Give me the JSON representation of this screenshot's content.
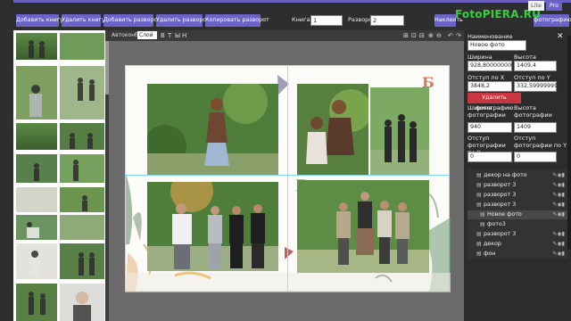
{
  "toolbar": {
    "add_book": "Добавить книгу",
    "delete_book": "Удалить книгу",
    "add_spread": "Добавить разворот",
    "delete_spread": "Удалить разворот",
    "copy_spread": "Копировать разворот",
    "book_label": "Книга:",
    "book_value": "1",
    "spread_label": "Разворот:",
    "spread_value": "2",
    "apply_photo": "Наклеить",
    "apply_photo_right": "фотографию"
  },
  "brand": {
    "logo": "FotoPIERA.RU",
    "lite": "Lite",
    "pro": "Pro"
  },
  "editor": {
    "autofill_label": "Автоконбор:",
    "autofill_value": "Слой",
    "icon_labels": [
      "В",
      "Т",
      "Ы",
      "Н"
    ]
  },
  "properties": {
    "name_label": "Наименование",
    "name_value": "Новое фото",
    "width_label": "Ширина",
    "width_value": "928,800000000",
    "height_label": "Высота",
    "height_value": "1409,4",
    "offset_x_label": "Отступ по X",
    "offset_x_value": "3848,2",
    "offset_y_label": "Отступ по Y",
    "offset_y_value": "332,599999999",
    "delete_photo_button": "Удалить фотографию",
    "photo_width_label": "Ширина фотографии",
    "photo_width_value": "940",
    "photo_height_label": "Высота фотографии",
    "photo_height_value": "1409",
    "photo_offset_x_label": "Отступ фотографии по X",
    "photo_offset_x_value": "0",
    "photo_offset_y_label": "Отступ фотографии по Y",
    "photo_offset_y_value": "0"
  },
  "layers": [
    {
      "label": "декор на фото",
      "indent": 0,
      "active": false
    },
    {
      "label": "разворот 3",
      "indent": 0,
      "active": false
    },
    {
      "label": "разворот 3",
      "indent": 0,
      "active": false
    },
    {
      "label": "разворот 3",
      "indent": 0,
      "active": false
    },
    {
      "label": "Новое фото",
      "indent": 1,
      "active": true
    },
    {
      "label": "фото3",
      "indent": 1,
      "active": false
    },
    {
      "label": "разворот 3",
      "indent": 0,
      "active": false
    },
    {
      "label": "декор",
      "indent": 0,
      "active": false
    },
    {
      "label": "фон",
      "indent": 0,
      "active": false
    }
  ],
  "colors": {
    "accent": "#6c63c9",
    "danger": "#c8363f",
    "logo": "#35d13a"
  }
}
